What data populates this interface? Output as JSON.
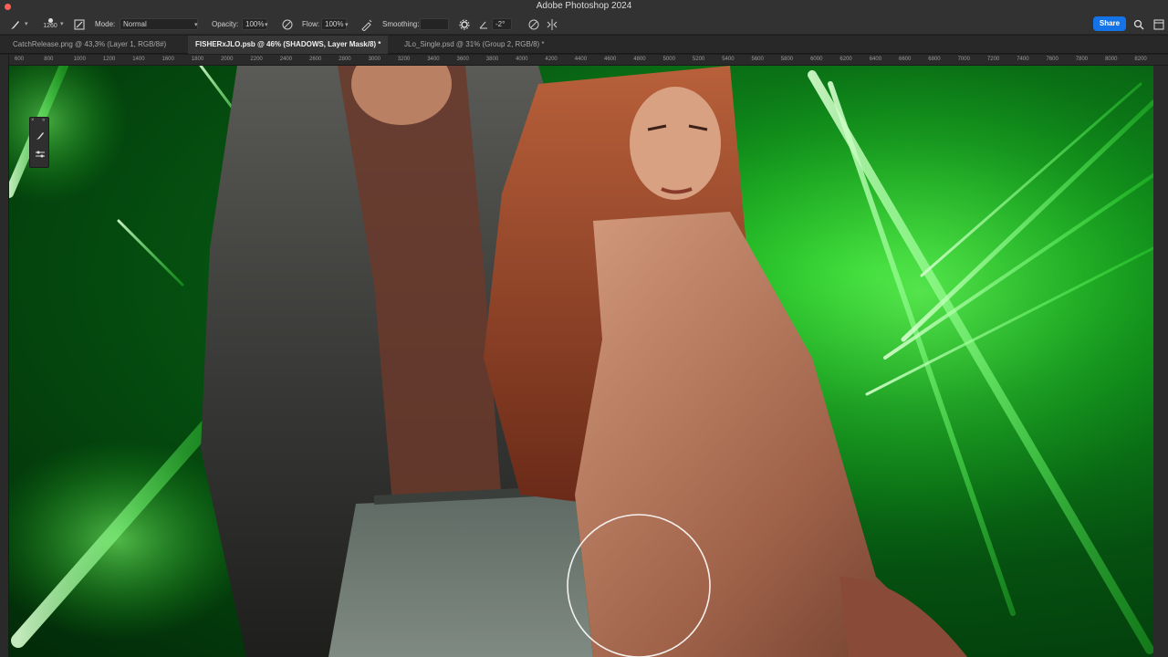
{
  "app": {
    "title": "Adobe Photoshop 2024"
  },
  "options": {
    "brush_size": "1260",
    "mode_label": "Mode:",
    "mode_value": "Normal",
    "opacity_label": "Opacity:",
    "opacity_value": "100%",
    "flow_label": "Flow:",
    "flow_value": "100%",
    "smoothing_label": "Smoothing:",
    "smoothing_value": "",
    "angle_value": "-2°",
    "share_label": "Share"
  },
  "tabs": [
    {
      "label": "CatchRelease.png @ 43,3% (Layer 1, RGB/8#)"
    },
    {
      "label": "FISHERxJLO.psb @ 46% (SHADOWS, Layer Mask/8) *"
    },
    {
      "label": "JLo_Single.psd @ 31% (Group 2, RGB/8) *"
    }
  ],
  "ruler_top": [
    "600",
    "800",
    "1000",
    "1200",
    "1400",
    "1600",
    "1800",
    "2000",
    "2200",
    "2400",
    "2600",
    "2800",
    "3000",
    "3200",
    "3400",
    "3600",
    "3800",
    "4000",
    "4200",
    "4400",
    "4600",
    "4800",
    "5000",
    "5200",
    "5400",
    "5600",
    "5800",
    "6000",
    "6200",
    "6400",
    "6600",
    "6800",
    "7000",
    "7200",
    "7400",
    "7600",
    "7800",
    "8000",
    "8200"
  ],
  "colors": {
    "share_blue": "#1473e6",
    "laser_green": "#2dd42d"
  },
  "icons": {
    "brush": "brush-icon",
    "brush_settings": "brush-settings-icon",
    "airbrush": "airbrush-icon",
    "angle": "angle-icon",
    "settings": "gear-icon",
    "search": "search-icon"
  }
}
